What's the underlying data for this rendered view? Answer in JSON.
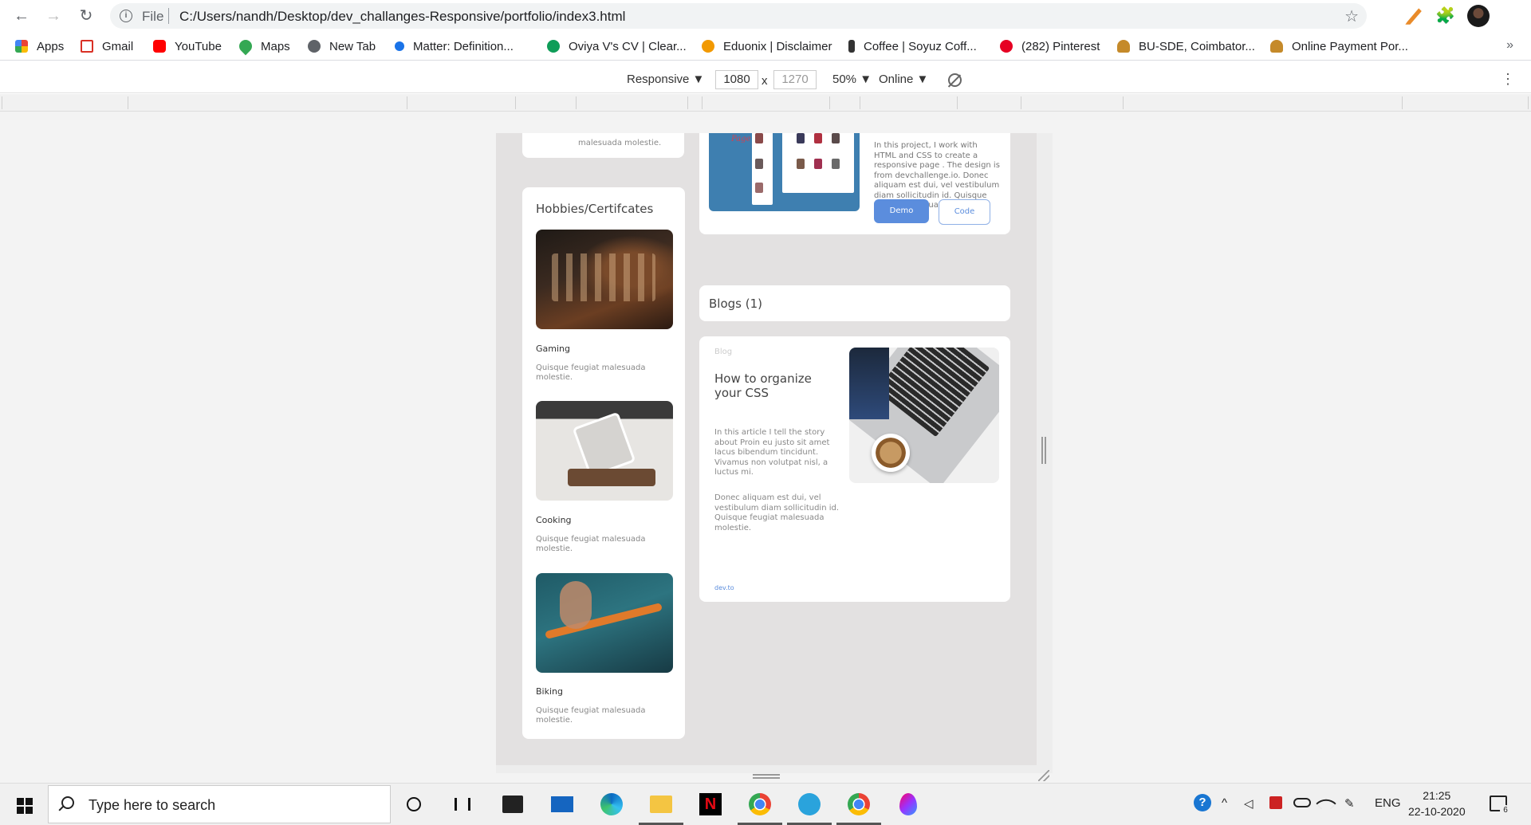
{
  "browser": {
    "nav": {
      "back": "←",
      "forward": "→",
      "reload": "↻"
    },
    "omnibox": {
      "scheme_label": "File",
      "url": "C:/Users/nandh/Desktop/dev_challanges-Responsive/portfolio/index3.html",
      "star": "☆"
    },
    "extensions": {
      "puzzle": "🧩"
    },
    "bookmarks": [
      {
        "label": "Apps",
        "icon": "apps-grid-icon",
        "color": "#ea4335"
      },
      {
        "label": "Gmail",
        "icon": "gmail-icon",
        "color": "#d93025"
      },
      {
        "label": "YouTube",
        "icon": "youtube-icon",
        "color": "#ff0000"
      },
      {
        "label": "Maps",
        "icon": "maps-pin-icon",
        "color": "#34a853"
      },
      {
        "label": "New Tab",
        "icon": "globe-icon",
        "color": "#5f6368"
      },
      {
        "label": "Matter: Definition...",
        "icon": "matter-icon",
        "color": "#1a73e8"
      },
      {
        "label": "Oviya V's CV | Clear...",
        "icon": "cv-icon",
        "color": "#0f9d58"
      },
      {
        "label": "Eduonix | Disclaimer",
        "icon": "eduonix-icon",
        "color": "#f29900"
      },
      {
        "label": "Coffee | Soyuz Coff...",
        "icon": "coffee-icon",
        "color": "#333333"
      },
      {
        "label": "(282) Pinterest",
        "icon": "pinterest-icon",
        "color": "#e60023"
      },
      {
        "label": "BU-SDE, Coimbator...",
        "icon": "person-icon",
        "color": "#c58a2a"
      },
      {
        "label": "Online Payment Por...",
        "icon": "person-icon",
        "color": "#c58a2a"
      }
    ],
    "bookmarks_more": "»"
  },
  "devtools": {
    "device": "Responsive ▼",
    "width": "1080",
    "times": "x",
    "height": "1270",
    "zoom": "50% ▼",
    "network": "Online ▼",
    "kebab": "⋮"
  },
  "page": {
    "top_stub_text": "malesuada molestie.",
    "hobbies": {
      "title": "Hobbies/Certifcates",
      "items": [
        {
          "name": "Gaming",
          "desc": "Quisque feugiat malesuada molestie."
        },
        {
          "name": "Cooking",
          "desc": "Quisque feugiat malesuada molestie."
        },
        {
          "name": "Biking",
          "desc": "Quisque feugiat malesuada molestie."
        }
      ]
    },
    "project": {
      "image_script": "Page",
      "text": "In this project, I work with HTML and CSS to create a responsive page . The design is from devchallenge.io. Donec aliquam est dui, vel vestibulum diam sollicitudin id. Quisque feugiat malesuada molestie.",
      "demo_label": "Demo",
      "code_label": "Code"
    },
    "blogs": {
      "heading": "Blogs (1)",
      "post": {
        "tag": "Blog",
        "title": "How to organize your CSS",
        "p1": "In this article I tell the story about Proin eu justo sit amet lacus bibendum tincidunt. Vivamus non volutpat nisl, a luctus mi.",
        "p2": "Donec aliquam est dui, vel vestibulum diam sollicitudin id. Quisque feugiat malesuada molestie.",
        "link": "dev.to"
      }
    }
  },
  "taskbar": {
    "search_placeholder": "Type here to search",
    "tray": {
      "language": "ENG"
    },
    "time": "21:25",
    "date": "22-10-2020",
    "notification_count": "6"
  }
}
